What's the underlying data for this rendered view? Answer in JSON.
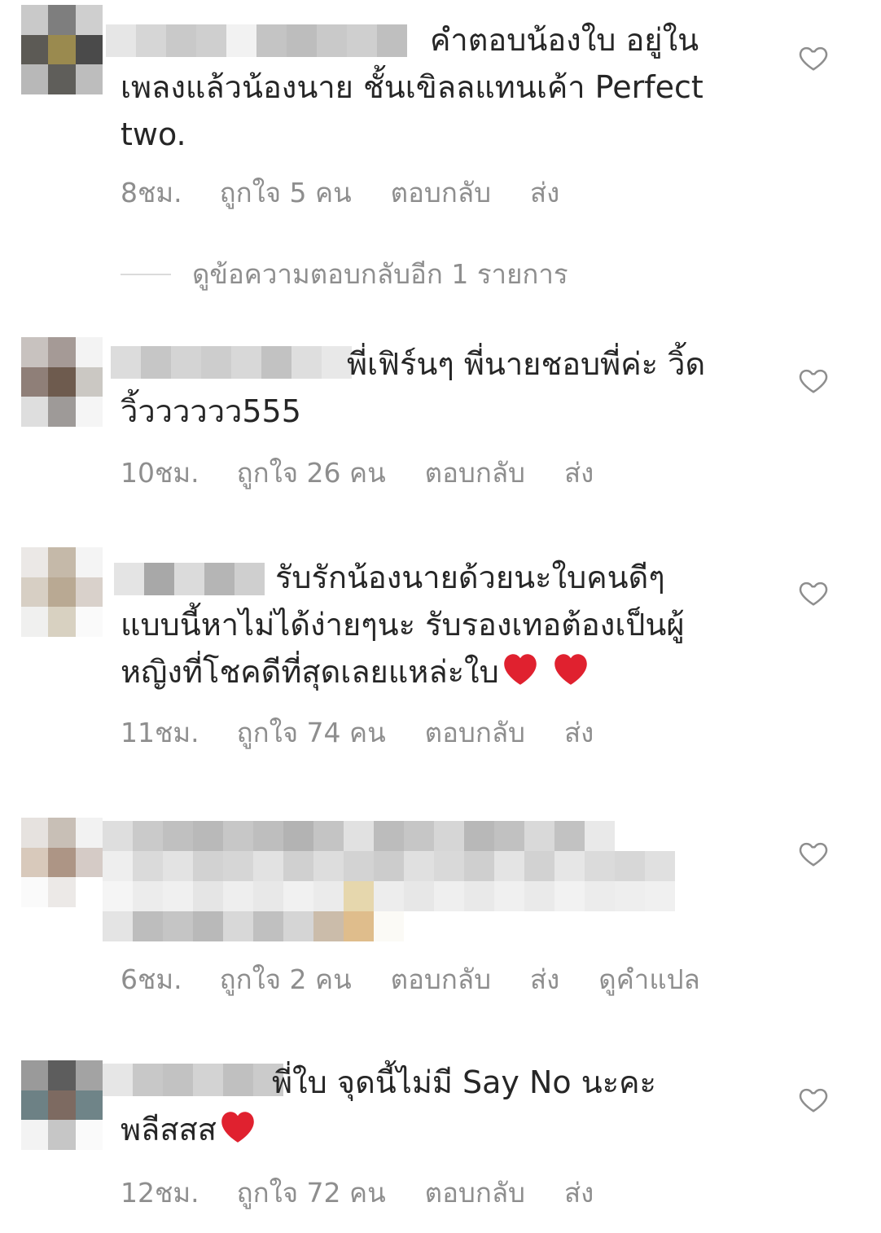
{
  "comments": [
    {
      "text": "คำตอบน้องใบ อยู่ใน\nเพลงแล้วน้องนาย ชั้นเขิลลแทนเค้า Perfect\ntwo.",
      "time": "8ชม.",
      "likes": "ถูกใจ 5 คน",
      "reply": "ตอบกลับ",
      "send": "ส่ง"
    },
    {
      "text": "พี่เฟิร์นๆ พี่นายชอบพี่ค่ะ วิ้ด\nวิ้วววววว555",
      "time": "10ชม.",
      "likes": "ถูกใจ 26 คน",
      "reply": "ตอบกลับ",
      "send": "ส่ง"
    },
    {
      "text": "รับรักน้องนายด้วยนะใบคนดีๆ\nแบบนี้หาไม่ได้ง่ายๆนะ รับรองเทอต้องเป็นผู้\nหญิงที่โชคดีที่สุดเลยแหล่ะใบ",
      "time": "11ชม.",
      "likes": "ถูกใจ 74 คน",
      "reply": "ตอบกลับ",
      "send": "ส่ง"
    },
    {
      "time": "6ชม.",
      "likes": "ถูกใจ 2 คน",
      "reply": "ตอบกลับ",
      "send": "ส่ง",
      "translate": "ดูคำแปล"
    },
    {
      "text": "พี่ใบ จุดนี้ไม่มี Say No นะคะ\nพลีสสส",
      "time": "12ชม.",
      "likes": "ถูกใจ 72 คน",
      "reply": "ตอบกลับ",
      "send": "ส่ง"
    }
  ],
  "view_replies": "ดูข้อความตอบกลับอีก 1 รายการ",
  "colors": {
    "text": "#262626",
    "meta": "#8e8e8e",
    "heart_outline": "#8e8e8e",
    "emoji_heart": "#e0212f"
  },
  "icons": {
    "like": "heart-outline-icon",
    "emoji": "red-heart-emoji"
  }
}
